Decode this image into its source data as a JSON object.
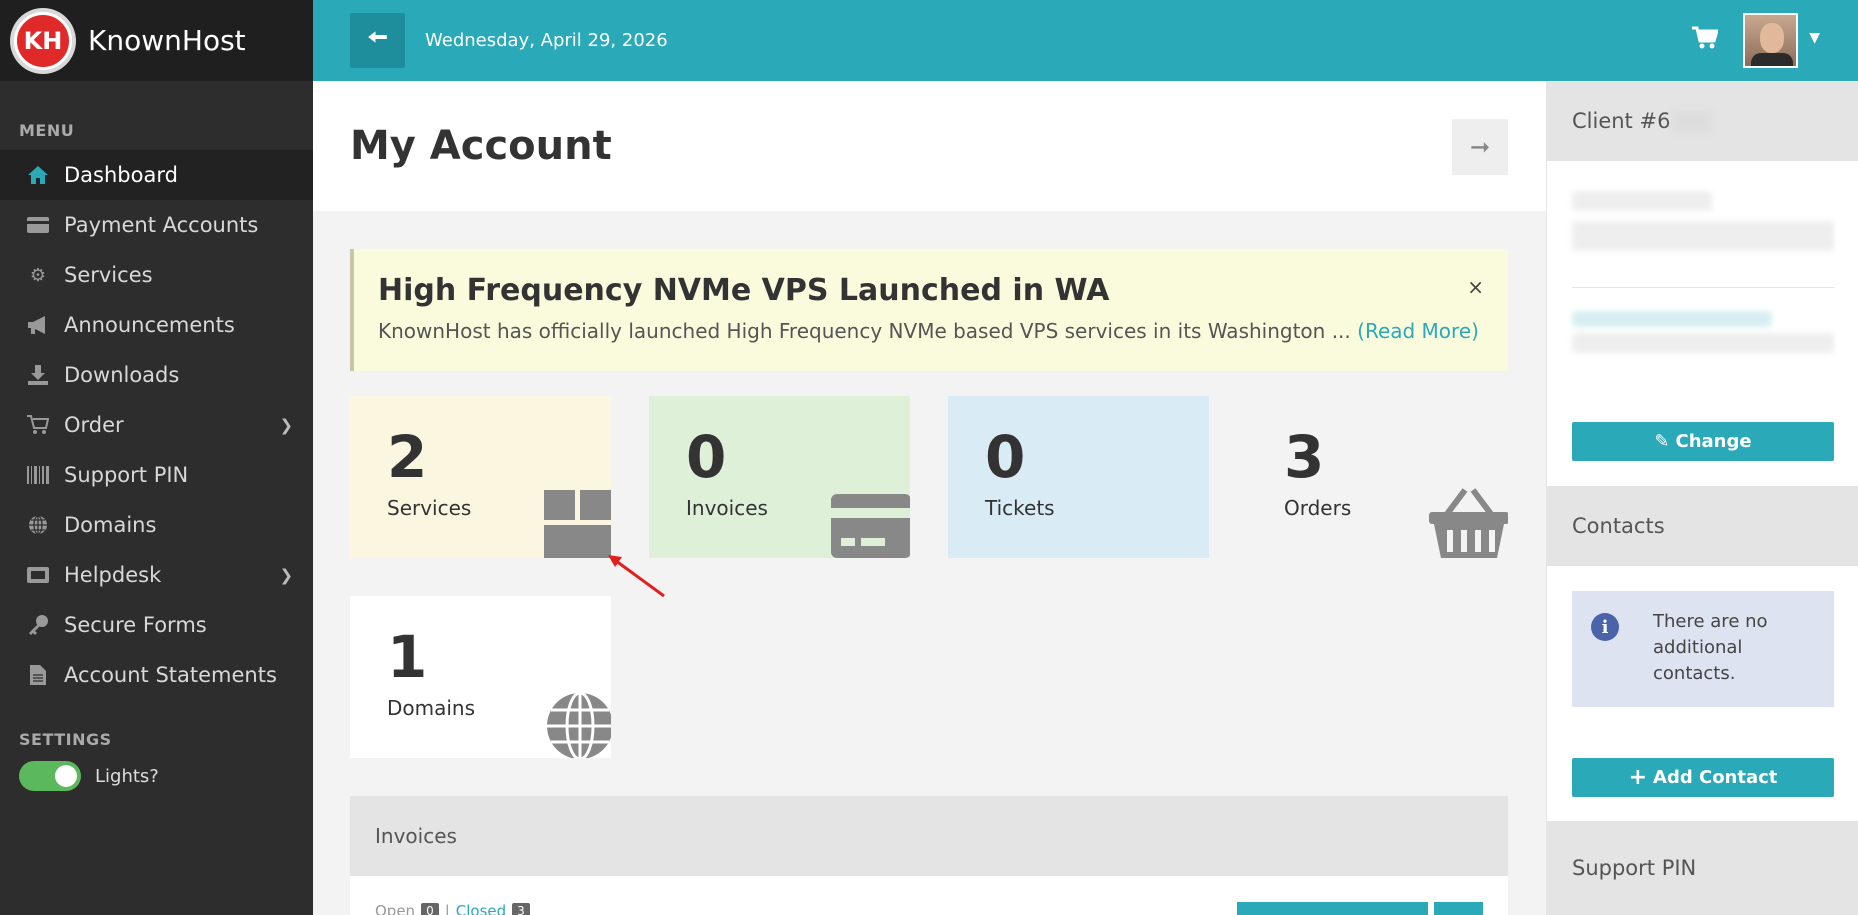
{
  "brand": {
    "logo_text": "KH",
    "name": "KnownHost"
  },
  "sidebar": {
    "menu_title": "MENU",
    "items": [
      {
        "label": "Dashboard",
        "icon": "home-icon",
        "active": true
      },
      {
        "label": "Payment Accounts",
        "icon": "credit-card-icon"
      },
      {
        "label": "Services",
        "icon": "gears-icon"
      },
      {
        "label": "Announcements",
        "icon": "megaphone-icon"
      },
      {
        "label": "Downloads",
        "icon": "download-icon"
      },
      {
        "label": "Order",
        "icon": "cart-icon",
        "submenu": true
      },
      {
        "label": "Support PIN",
        "icon": "barcode-icon"
      },
      {
        "label": "Domains",
        "icon": "globe-icon"
      },
      {
        "label": "Helpdesk",
        "icon": "ticket-icon",
        "submenu": true
      },
      {
        "label": "Secure Forms",
        "icon": "key-icon"
      },
      {
        "label": "Account Statements",
        "icon": "document-icon"
      }
    ],
    "settings_title": "SETTINGS",
    "lights_label": "Lights?",
    "lights_on": true
  },
  "topbar": {
    "date": "Wednesday, April 29, 2026"
  },
  "page": {
    "title": "My Account"
  },
  "announcement": {
    "title": "High Frequency NVMe VPS Launched in WA",
    "body": "KnownHost has officially launched High Frequency NVMe based VPS services in its Washington ...",
    "read_more": "(Read More)",
    "close": "×"
  },
  "stats": [
    {
      "value": "2",
      "label": "Services",
      "bg": "#fbf6e0",
      "icon": "box-icon"
    },
    {
      "value": "0",
      "label": "Invoices",
      "bg": "#dff0d8",
      "icon": "credit-card-icon"
    },
    {
      "value": "0",
      "label": "Tickets",
      "bg": "#d9ecf6",
      "icon": "ticket-icon"
    },
    {
      "value": "3",
      "label": "Orders",
      "bg": "#f3f3f3",
      "icon": "basket-icon"
    },
    {
      "value": "1",
      "label": "Domains",
      "bg": "#ffffff",
      "icon": "globe-icon"
    }
  ],
  "right": {
    "client_label": "Client #6",
    "change_label": "Change",
    "contacts_title": "Contacts",
    "no_contacts": "There are no additional contacts.",
    "add_contact": "Add Contact",
    "support_pin_title": "Support PIN"
  },
  "invoices_panel": {
    "title": "Invoices",
    "tab_open": "Open",
    "open_count": "0",
    "tab_closed": "Closed",
    "closed_count": "3"
  }
}
